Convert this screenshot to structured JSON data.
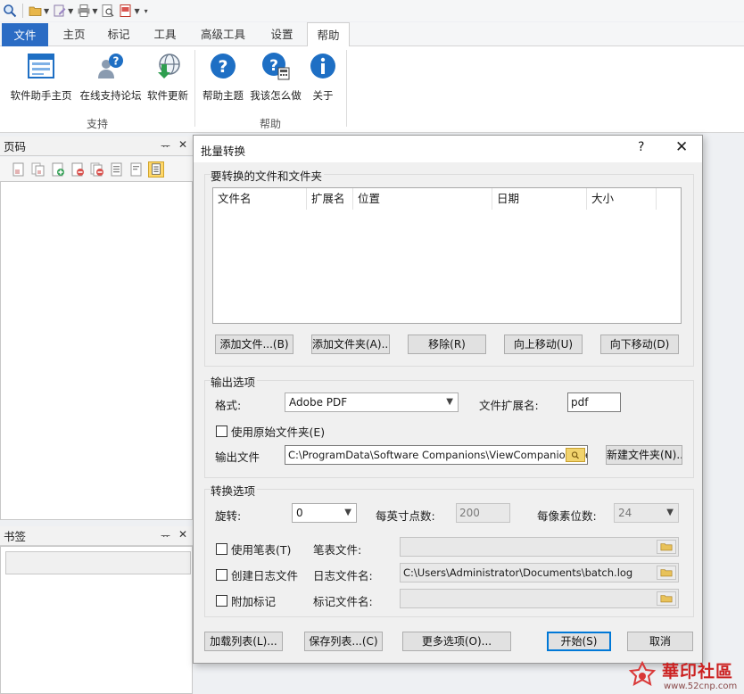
{
  "ribbon_tabs": {
    "file": "文件",
    "home": "主页",
    "mark": "标记",
    "tools": "工具",
    "advanced": "高级工具",
    "settings": "设置",
    "help": "帮助"
  },
  "ribbon": {
    "support_home": "软件助手主页",
    "online_forum": "在线支持论坛",
    "update": "软件更新",
    "support_group": "支持",
    "help_topics": "帮助主题",
    "how_to": "我该怎么做",
    "about": "关于",
    "help_group": "帮助"
  },
  "left": {
    "pages_title": "页码",
    "bookmarks_title": "书签",
    "pin": "ᅲ",
    "close": "✕"
  },
  "dialog": {
    "title": "批量转换",
    "help": "?",
    "close": "✕",
    "files_group": "要转换的文件和文件夹",
    "columns": [
      "文件名",
      "扩展名",
      "位置",
      "日期",
      "大小"
    ],
    "add_file": "添加文件...(B)",
    "add_folder": "添加文件夹(A)...",
    "remove": "移除(R)",
    "move_up": "向上移动(U)",
    "move_down": "向下移动(D)",
    "output_group": "输出选项",
    "format_label": "格式:",
    "format_value": "Adobe PDF",
    "ext_label": "文件扩展名:",
    "ext_value": "pdf",
    "use_original_folder": "使用原始文件夹(E)",
    "output_file_label": "输出文件",
    "output_path": "C:\\ProgramData\\Software Companions\\ViewCompanion Premium",
    "new_folder": "新建文件夹(N)...",
    "convert_group": "转换选项",
    "rotate_label": "旋转:",
    "rotate_value": "0",
    "dpi_label": "每英寸点数:",
    "dpi_value": "200",
    "bpp_label": "每像素位数:",
    "bpp_value": "24",
    "use_pen": "使用笔表(T)",
    "pen_file_label": "笔表文件:",
    "pen_file_value": "",
    "create_log": "创建日志文件",
    "log_file_label": "日志文件名:",
    "log_file_value": "C:\\Users\\Administrator\\Documents\\batch.log",
    "attach_mark": "附加标记",
    "mark_file_label": "标记文件名:",
    "mark_file_value": "",
    "load_list": "加载列表(L)...",
    "save_list": "保存列表...(C)",
    "more_options": "更多选项(O)...",
    "start": "开始(S)",
    "cancel": "取消"
  },
  "watermark": {
    "text": "華印社區",
    "url": "www.52cnp.com"
  },
  "colors": {
    "file_tab": "#2b6cc4",
    "icon_blue": "#1e6fc4",
    "dialog_bg": "#f0f0f0"
  }
}
